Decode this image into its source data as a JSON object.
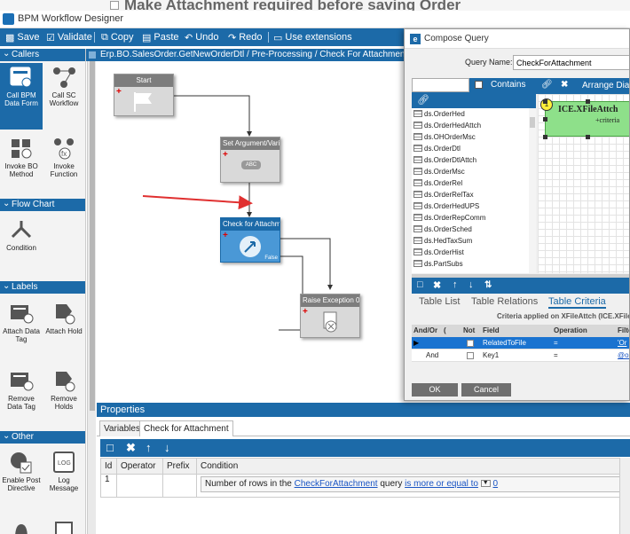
{
  "behind_window": {
    "title": "Make Attachment required before saving Order"
  },
  "app": {
    "title": "BPM Workflow Designer"
  },
  "toolbar": {
    "save": "Save",
    "validate": "Validate",
    "copy": "Copy",
    "paste": "Paste",
    "undo": "Undo",
    "redo": "Redo",
    "use_extensions": "Use extensions"
  },
  "breadcrumb": "Erp.BO.SalesOrder.GetNewOrderDtl / Pre-Processing / Check For Attachment",
  "palette": {
    "callers": {
      "label": "Callers",
      "items": [
        "Call BPM Data Form",
        "Call SC Workflow",
        "Invoke BO Method",
        "Invoke Function"
      ]
    },
    "flow_chart": {
      "label": "Flow Chart",
      "items": [
        "Condition"
      ]
    },
    "labels": {
      "label": "Labels",
      "items": [
        "Attach Data Tag",
        "Attach Hold",
        "Remove Data Tag",
        "Remove Holds"
      ]
    },
    "other": {
      "label": "Other",
      "items": [
        "Enable Post Directive",
        "Log Message"
      ]
    }
  },
  "nodes": {
    "start": "Start",
    "set_arg": "Set Argument/Vari",
    "set_arg_icon_text": "ABC",
    "check": "Check for Attachm",
    "check_false": "False",
    "raise": "Raise Exception 0"
  },
  "properties": {
    "header": "Properties",
    "tabs": [
      "Variables",
      "Check for Attachment"
    ],
    "columns": [
      "Id",
      "Operator",
      "Prefix",
      "Condition"
    ],
    "row": {
      "id": "1",
      "cond_prefix": "Number of rows in the",
      "cond_query": "CheckForAttachment",
      "cond_mid": "query",
      "cond_op": "is more or equal to",
      "cond_value": "0"
    }
  },
  "compose_query": {
    "title": "Compose Query",
    "query_name_label": "Query Name:",
    "query_name": "CheckForAttachment",
    "contains": "Contains",
    "arrange": "Arrange Diagram",
    "datasets": [
      "ds.OrderHed",
      "ds.OrderHedAttch",
      "ds.OHOrderMsc",
      "ds.OrderDtl",
      "ds.OrderDtlAttch",
      "ds.OrderMsc",
      "ds.OrderRel",
      "ds.OrderRelTax",
      "ds.OrderHedUPS",
      "ds.OrderRepComm",
      "ds.OrderSched",
      "ds.HedTaxSum",
      "ds.OrderHist",
      "ds.PartSubs"
    ],
    "table": {
      "name": "ICE.XFileAttch",
      "subtitle": "+criteria",
      "badge": "1"
    },
    "crit_tabs": [
      "Table List",
      "Table Relations",
      "Table Criteria"
    ],
    "crit_caption": "Criteria applied on XFileAttch (ICE.XFile",
    "crit_columns": [
      "And/Or",
      "(",
      "Not",
      "Field",
      "Operation",
      "Filte"
    ],
    "crit_rows": [
      {
        "andor": "",
        "field": "RelatedToFile",
        "op": "=",
        "filter": "'Or"
      },
      {
        "andor": "And",
        "field": "Key1",
        "op": "=",
        "filter": "@or"
      }
    ],
    "ok": "OK",
    "cancel": "Cancel"
  }
}
